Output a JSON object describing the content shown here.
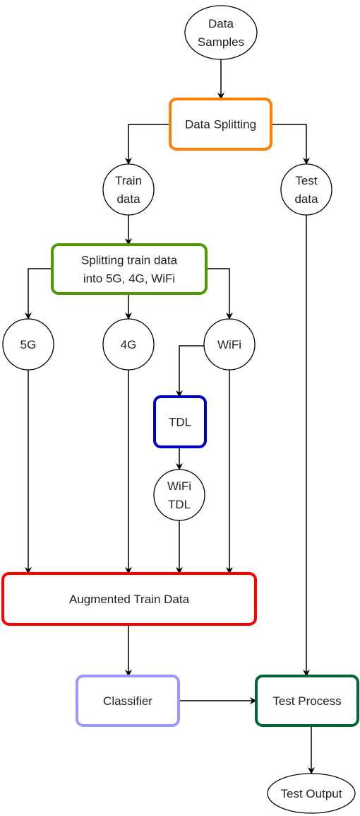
{
  "diagram": {
    "type": "flowchart",
    "nodes": [
      {
        "id": "data_samples",
        "shape": "ellipse",
        "lines": [
          "Data",
          "Samples"
        ],
        "stroke": "#000000"
      },
      {
        "id": "data_splitting",
        "shape": "rounded-rect",
        "lines": [
          "Data Splitting"
        ],
        "stroke": "#ff8000"
      },
      {
        "id": "train_data",
        "shape": "circle",
        "lines": [
          "Train",
          "data"
        ],
        "stroke": "#000000"
      },
      {
        "id": "test_data",
        "shape": "circle",
        "lines": [
          "Test",
          "data"
        ],
        "stroke": "#000000"
      },
      {
        "id": "split_train",
        "shape": "rounded-rect",
        "lines": [
          "Splitting train data",
          "into 5G, 4G, WiFi"
        ],
        "stroke": "#4d9900"
      },
      {
        "id": "g5",
        "shape": "circle",
        "lines": [
          "5G"
        ],
        "stroke": "#000000"
      },
      {
        "id": "g4",
        "shape": "circle",
        "lines": [
          "4G"
        ],
        "stroke": "#000000"
      },
      {
        "id": "wifi",
        "shape": "circle",
        "lines": [
          "WiFi"
        ],
        "stroke": "#000000"
      },
      {
        "id": "tdl",
        "shape": "rounded-rect",
        "lines": [
          "TDL"
        ],
        "stroke": "#0000cc"
      },
      {
        "id": "wifi_tdl",
        "shape": "circle",
        "lines": [
          "WiFi",
          "TDL"
        ],
        "stroke": "#000000"
      },
      {
        "id": "augmented",
        "shape": "rounded-rect",
        "lines": [
          "Augmented Train Data"
        ],
        "stroke": "#ff0000"
      },
      {
        "id": "classifier",
        "shape": "rounded-rect",
        "lines": [
          "Classifier"
        ],
        "stroke": "#9999ff"
      },
      {
        "id": "test_process",
        "shape": "rounded-rect",
        "lines": [
          "Test Process"
        ],
        "stroke": "#006633"
      },
      {
        "id": "test_output",
        "shape": "ellipse",
        "lines": [
          "Test Output"
        ],
        "stroke": "#000000"
      }
    ],
    "edges": [
      {
        "from": "data_samples",
        "to": "data_splitting"
      },
      {
        "from": "data_splitting",
        "to": "train_data"
      },
      {
        "from": "data_splitting",
        "to": "test_data"
      },
      {
        "from": "train_data",
        "to": "split_train"
      },
      {
        "from": "split_train",
        "to": "g5"
      },
      {
        "from": "split_train",
        "to": "g4"
      },
      {
        "from": "split_train",
        "to": "wifi"
      },
      {
        "from": "wifi",
        "to": "tdl"
      },
      {
        "from": "tdl",
        "to": "wifi_tdl"
      },
      {
        "from": "g5",
        "to": "augmented"
      },
      {
        "from": "g4",
        "to": "augmented"
      },
      {
        "from": "wifi_tdl",
        "to": "augmented"
      },
      {
        "from": "wifi",
        "to": "augmented"
      },
      {
        "from": "augmented",
        "to": "classifier"
      },
      {
        "from": "classifier",
        "to": "test_process"
      },
      {
        "from": "test_data",
        "to": "test_process"
      },
      {
        "from": "test_process",
        "to": "test_output"
      }
    ]
  }
}
